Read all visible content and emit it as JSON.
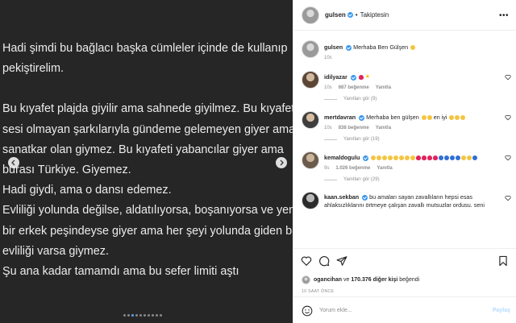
{
  "post": {
    "lines": [
      "Hadi şimdi bu bağlacı başka cümleler içinde de kullanıp",
      "pekiştirelim.",
      "",
      "Bu kıyafet plajda giyilir ama sahnede giyilmez. Bu kıyafeti",
      "sesi olmayan şarkılarıyla gündeme gelemeyen giyer ama",
      "sanatkar olan giymez. Bu kıyafeti yabancılar giyer ama",
      "burası Türkiye. Giyemez.",
      "Hadi giydi,  ama o dansı edemez.",
      "Evliliği yolunda değilse, aldatılıyorsa, boşanıyorsa ve yeni",
      "bir erkek peşindeyse giyer ama her şeyi yolunda giden bir",
      "evliliği varsa giymez.",
      "Şu ana kadar tamamdı ama bu sefer limiti aştı"
    ],
    "carousel_dots": 10,
    "active_dot": 2
  },
  "header": {
    "username": "gulsen",
    "separator": "•",
    "follow_status": "Takiptesin",
    "more": "•••"
  },
  "caption": {
    "username": "gulsen",
    "text": "Merhaba Ben Gülşen",
    "time": "10s"
  },
  "comments": [
    {
      "username": "idilyazar",
      "text": "",
      "emojis": [
        "red-heart",
        "star"
      ],
      "time": "10s",
      "likes": "687 beğenme",
      "reply": "Yanıtla",
      "replies": "Yanıtları gör (9)"
    },
    {
      "username": "mertdavran",
      "text": "Merhaba ben gülşen",
      "text2": "en iyi",
      "time": "10s",
      "likes": "838 beğenme",
      "reply": "Yanıtla",
      "replies": "Yanıtları gör (19)"
    },
    {
      "username": "kemaldogulu",
      "text": "",
      "time": "9s",
      "likes": "1.026 beğenme",
      "reply": "Yanıtla",
      "replies": "Yanıtları gör (29)"
    },
    {
      "username": "kaan.sekban",
      "text": "bu amaları sayan zavallıların hepsi esas ahlaksızlıklarını örtmeye çalışan zavallı mutsuzlar ordusu. seni"
    }
  ],
  "likes": {
    "user": "ogancihan",
    "connector": "ve",
    "others": "170.376 diğer kişi",
    "suffix": "beğendi"
  },
  "ago": "10 SAAT ÖNCE",
  "add_comment": {
    "placeholder": "Yorum ekle...",
    "share": "Paylaş"
  }
}
